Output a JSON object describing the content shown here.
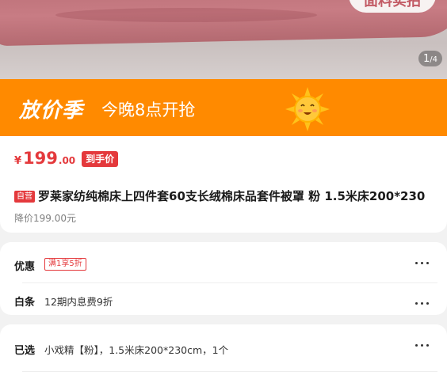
{
  "gallery": {
    "badge_text": "面料实拍",
    "pager_current": "1",
    "pager_separator": "/",
    "pager_total": "4"
  },
  "promo_banner": {
    "name": "放价季",
    "time_text": "今晚8点开抢",
    "mascot_icon": "sun-mascot-icon",
    "color": "#ff8a00"
  },
  "price": {
    "currency": "¥",
    "integer": "199",
    "decimal": ".00",
    "tag": "到手价",
    "color": "#e4393c"
  },
  "product": {
    "self_operated_tag": "自营",
    "title": "罗莱家纺纯棉床上四件套60支长绒棉床品套件被罩 粉 1.5米床200*230",
    "original_price": "降价199.00元"
  },
  "promotions": {
    "discount_label": "优惠",
    "discount_coupon": "满1享5折",
    "baitiao_label": "白条",
    "baitiao_text": "12期内息费9折"
  },
  "selection": {
    "label": "已选",
    "value": "小戏精【粉】，1.5米床200*230cm，1个"
  }
}
